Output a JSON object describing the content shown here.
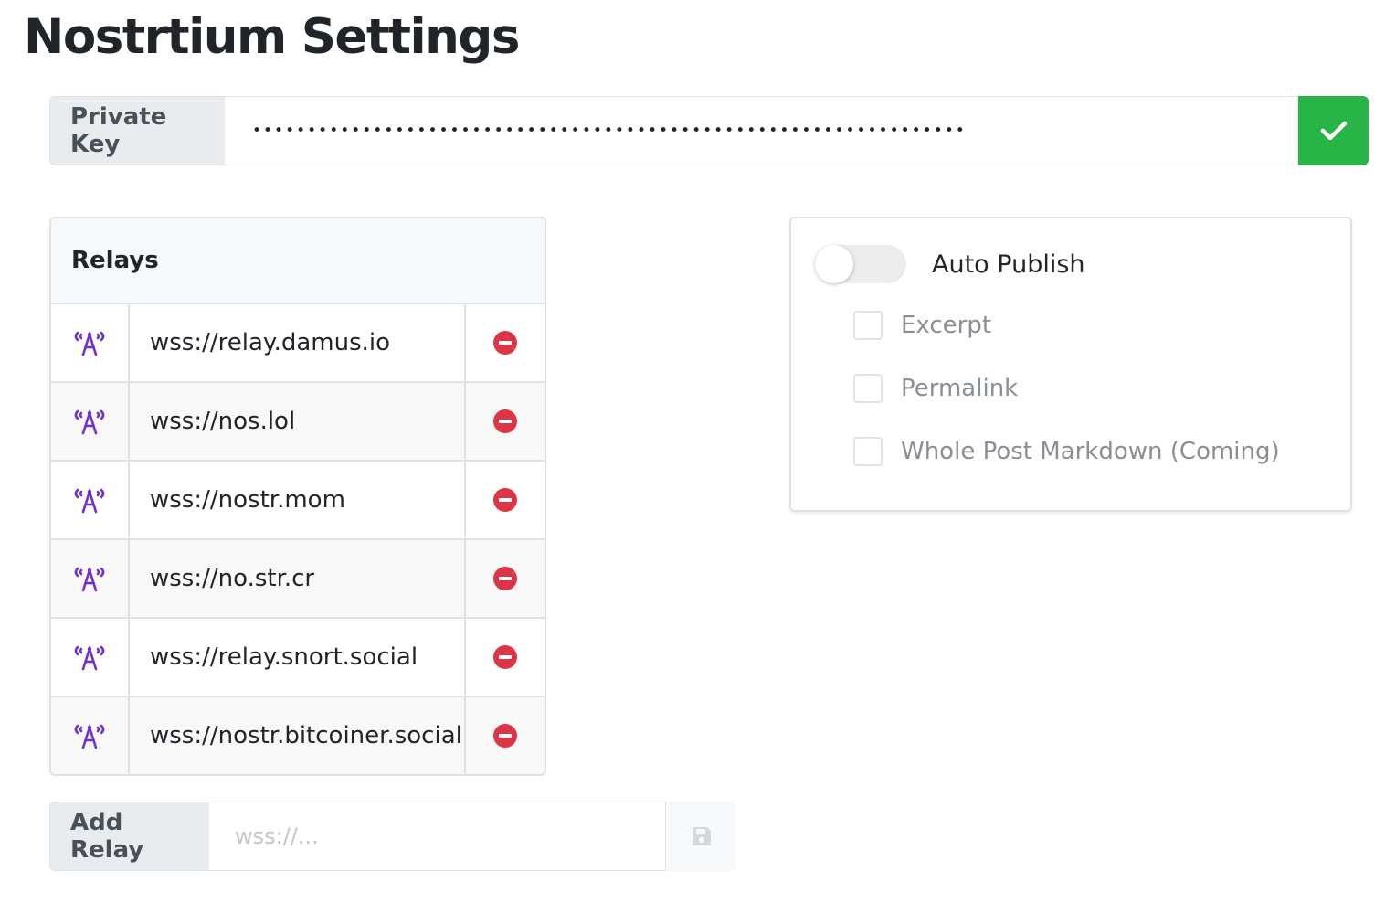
{
  "page": {
    "title": "Nostrtium Settings"
  },
  "private_key": {
    "label": "Private Key",
    "masked_value": "•••••••••••••••••••••••••••••••••••••••••••••••••••••••••••••••••",
    "confirm_icon": "check-icon"
  },
  "relays": {
    "title": "Relays",
    "items": [
      {
        "url": "wss://relay.damus.io"
      },
      {
        "url": "wss://nos.lol"
      },
      {
        "url": "wss://nostr.mom"
      },
      {
        "url": "wss://no.str.cr"
      },
      {
        "url": "wss://relay.snort.social"
      },
      {
        "url": "wss://nostr.bitcoiner.social"
      }
    ],
    "relay_icon": "broadcast-tower-icon",
    "remove_icon": "minus-circle-icon"
  },
  "add_relay": {
    "label": "Add Relay",
    "value": "",
    "placeholder": "wss://...",
    "save_icon": "save-icon"
  },
  "options": {
    "auto_publish": {
      "label": "Auto Publish",
      "enabled": false
    },
    "checkboxes": [
      {
        "label": "Excerpt",
        "checked": false
      },
      {
        "label": "Permalink",
        "checked": false
      },
      {
        "label": "Whole Post Markdown (Coming)",
        "checked": false
      }
    ]
  },
  "colors": {
    "confirm_green": "#28b446",
    "relay_icon_purple": "#6f2fd1",
    "remove_red": "#dc3545"
  }
}
